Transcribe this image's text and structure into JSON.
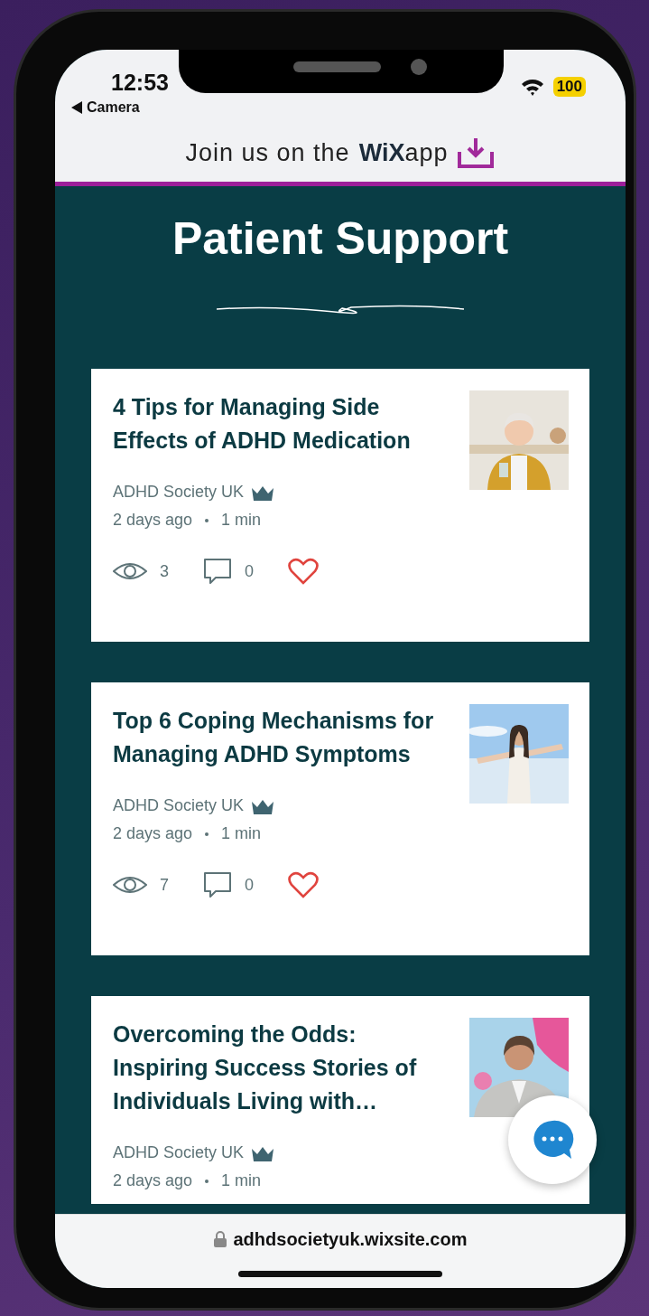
{
  "status_bar": {
    "time": "12:53",
    "back_label": "Camera",
    "battery": "100"
  },
  "app_banner": {
    "text": "Join us on the",
    "logo": "WiX",
    "suffix": "app"
  },
  "page_title": "Patient Support",
  "posts": [
    {
      "title": "4 Tips for Managing Side Effects of ADHD Medication",
      "author": "ADHD Society UK",
      "date": "2 days ago",
      "read_time": "1 min",
      "views": "3",
      "comments": "0",
      "liked": false
    },
    {
      "title": "Top 6 Coping Mechanisms for Managing ADHD Symptoms",
      "author": "ADHD Society UK",
      "date": "2 days ago",
      "read_time": "1 min",
      "views": "7",
      "comments": "0",
      "liked": false
    },
    {
      "title": "Overcoming the Odds: Inspiring Success Stories of Individuals Living with…",
      "author": "ADHD Society UK",
      "date": "2 days ago",
      "read_time": "1 min"
    }
  ],
  "url": "adhdsocietyuk.wixsite.com"
}
